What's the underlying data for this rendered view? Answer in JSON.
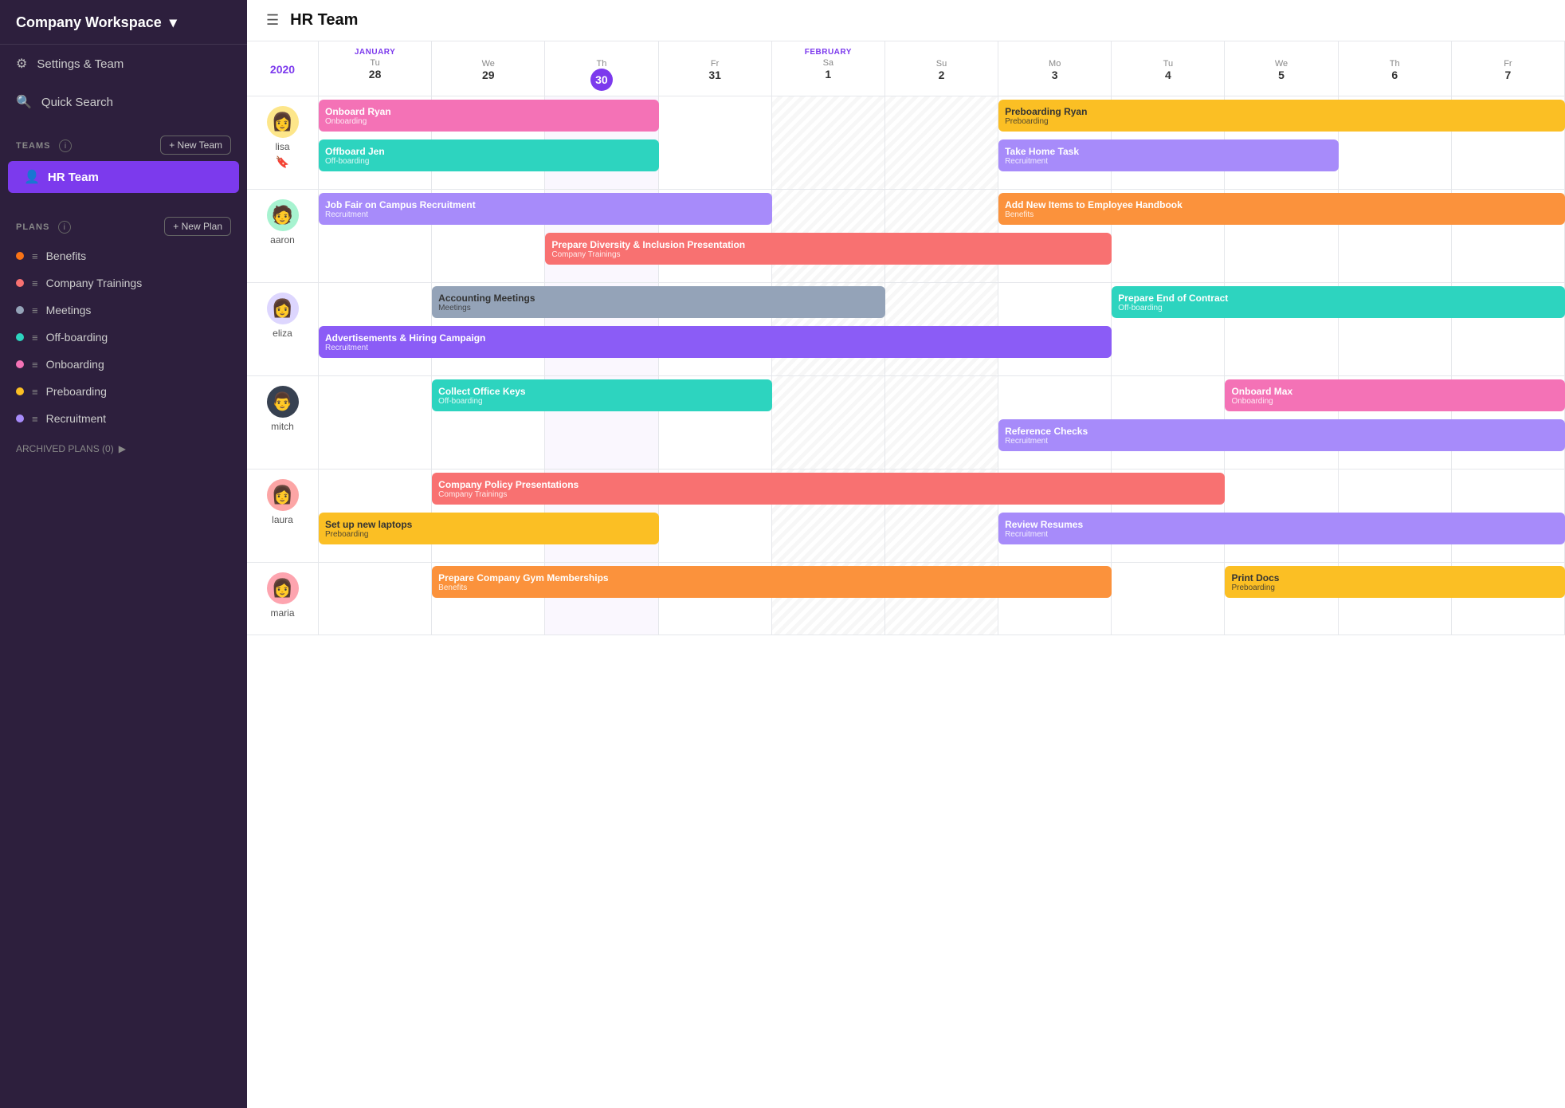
{
  "sidebar": {
    "workspace_name": "Company Workspace",
    "workspace_chevron": "▾",
    "nav_items": [
      {
        "id": "settings-team",
        "label": "Settings & Team",
        "icon": "⚙"
      },
      {
        "id": "quick-search",
        "label": "Quick Search",
        "icon": "🔍"
      }
    ],
    "teams_section": {
      "label": "TEAMS",
      "new_team_btn": "+ New Team",
      "teams": [
        {
          "id": "hr-team",
          "label": "HR Team",
          "active": true,
          "icon": "👤"
        }
      ]
    },
    "plans_section": {
      "label": "PLANS",
      "new_plan_btn": "+ New Plan",
      "plans": [
        {
          "id": "benefits",
          "label": "Benefits",
          "color": "#f97316"
        },
        {
          "id": "company-trainings",
          "label": "Company Trainings",
          "color": "#f87171"
        },
        {
          "id": "meetings",
          "label": "Meetings",
          "color": "#94a3b8"
        },
        {
          "id": "off-boarding",
          "label": "Off-boarding",
          "color": "#2dd4bf"
        },
        {
          "id": "onboarding",
          "label": "Onboarding",
          "color": "#f472b6"
        },
        {
          "id": "preboarding",
          "label": "Preboarding",
          "color": "#fbbf24"
        },
        {
          "id": "recruitment",
          "label": "Recruitment",
          "color": "#a78bfa"
        }
      ]
    },
    "archived_label": "ARCHIVED PLANS (0)"
  },
  "page_title": "HR Team",
  "calendar": {
    "year": "2020",
    "columns": [
      {
        "month": "JANUARY",
        "day_name": "Tu 28",
        "day_num": "28",
        "is_today": false,
        "is_weekend": false
      },
      {
        "month": "",
        "day_name": "We 29",
        "day_num": "29",
        "is_today": false,
        "is_weekend": false
      },
      {
        "month": "",
        "day_name": "Th 30",
        "day_num": "30",
        "is_today": true,
        "is_weekend": false
      },
      {
        "month": "",
        "day_name": "Fr 31",
        "day_num": "31",
        "is_today": false,
        "is_weekend": false
      },
      {
        "month": "FEBRUARY",
        "day_name": "Sa 1",
        "day_num": "1",
        "is_today": false,
        "is_weekend": true
      },
      {
        "month": "",
        "day_name": "Su 2",
        "day_num": "2",
        "is_today": false,
        "is_weekend": true
      },
      {
        "month": "",
        "day_name": "Mo 3",
        "day_num": "3",
        "is_today": false,
        "is_weekend": false
      },
      {
        "month": "",
        "day_name": "Tu 4",
        "day_num": "4",
        "is_today": false,
        "is_weekend": false
      },
      {
        "month": "",
        "day_name": "We 5",
        "day_num": "5",
        "is_today": false,
        "is_weekend": false
      },
      {
        "month": "",
        "day_name": "Th 6",
        "day_num": "6",
        "is_today": false,
        "is_weekend": false
      },
      {
        "month": "",
        "day_name": "Fr 7",
        "day_num": "7",
        "is_today": false,
        "is_weekend": false
      }
    ],
    "people": [
      {
        "name": "lisa",
        "avatar_emoji": "👩",
        "avatar_color": "#fde68a",
        "has_bookmark": true,
        "rows": [
          [
            {
              "title": "Onboard Ryan",
              "subtitle": "Onboarding",
              "color": "#f472b6",
              "col_start": 1,
              "col_span": 3
            },
            {
              "title": "Preboarding Ryan",
              "subtitle": "Preboarding",
              "color": "#fbbf24",
              "text_color": "#333",
              "col_start": 7,
              "col_span": 5
            }
          ],
          [
            {
              "title": "Offboard Jen",
              "subtitle": "Off-boarding",
              "color": "#2dd4bf",
              "col_start": 1,
              "col_span": 3
            },
            {
              "title": "Take Home Task",
              "subtitle": "Recruitment",
              "color": "#a78bfa",
              "col_start": 7,
              "col_span": 3
            }
          ]
        ]
      },
      {
        "name": "aaron",
        "avatar_emoji": "🧑",
        "avatar_color": "#a7f3d0",
        "has_bookmark": false,
        "rows": [
          [
            {
              "title": "Job Fair on Campus Recruitment",
              "subtitle": "Recruitment",
              "color": "#a78bfa",
              "col_start": 1,
              "col_span": 4
            },
            {
              "title": "Add New Items to Employee Handbook",
              "subtitle": "Benefits",
              "color": "#fb923c",
              "col_start": 7,
              "col_span": 5
            }
          ],
          [
            {
              "title": "Prepare Diversity & Inclusion Presentation",
              "subtitle": "Company Trainings",
              "color": "#f87171",
              "col_start": 3,
              "col_span": 5
            }
          ]
        ]
      },
      {
        "name": "eliza",
        "avatar_emoji": "👩",
        "avatar_color": "#ddd6fe",
        "has_bookmark": false,
        "rows": [
          [
            {
              "title": "Accounting Meetings",
              "subtitle": "Meetings",
              "color": "#94a3b8",
              "text_color": "#333",
              "col_start": 2,
              "col_span": 4
            },
            {
              "title": "Prepare End of Contract",
              "subtitle": "Off-boarding",
              "color": "#2dd4bf",
              "col_start": 8,
              "col_span": 4
            }
          ],
          [
            {
              "title": "Advertisements & Hiring Campaign",
              "subtitle": "Recruitment",
              "color": "#8b5cf6",
              "col_start": 1,
              "col_span": 7
            }
          ]
        ]
      },
      {
        "name": "mitch",
        "avatar_emoji": "👨",
        "avatar_color": "#374151",
        "has_bookmark": false,
        "rows": [
          [
            {
              "title": "Collect Office Keys",
              "subtitle": "Off-boarding",
              "color": "#2dd4bf",
              "col_start": 2,
              "col_span": 3
            },
            {
              "title": "Onboard Max",
              "subtitle": "Onboarding",
              "color": "#f472b6",
              "col_start": 9,
              "col_span": 3
            }
          ],
          [
            {
              "title": "Reference Checks",
              "subtitle": "Recruitment",
              "color": "#a78bfa",
              "col_start": 7,
              "col_span": 5
            }
          ]
        ]
      },
      {
        "name": "laura",
        "avatar_emoji": "👩",
        "avatar_color": "#fca5a5",
        "has_bookmark": false,
        "rows": [
          [
            {
              "title": "Company Policy Presentations",
              "subtitle": "Company Trainings",
              "color": "#f87171",
              "col_start": 2,
              "col_span": 7
            }
          ],
          [
            {
              "title": "Set up new laptops",
              "subtitle": "Preboarding",
              "color": "#fbbf24",
              "text_color": "#333",
              "col_start": 1,
              "col_span": 3
            },
            {
              "title": "Review Resumes",
              "subtitle": "Recruitment",
              "color": "#a78bfa",
              "col_start": 7,
              "col_span": 5
            }
          ]
        ]
      },
      {
        "name": "maria",
        "avatar_emoji": "👩",
        "avatar_color": "#fda4af",
        "has_bookmark": false,
        "rows": [
          [
            {
              "title": "Prepare Company Gym Memberships",
              "subtitle": "Benefits",
              "color": "#fb923c",
              "col_start": 2,
              "col_span": 6
            },
            {
              "title": "Print Docs",
              "subtitle": "Preboarding",
              "color": "#fbbf24",
              "text_color": "#333",
              "col_start": 9,
              "col_span": 3
            }
          ]
        ]
      }
    ]
  }
}
